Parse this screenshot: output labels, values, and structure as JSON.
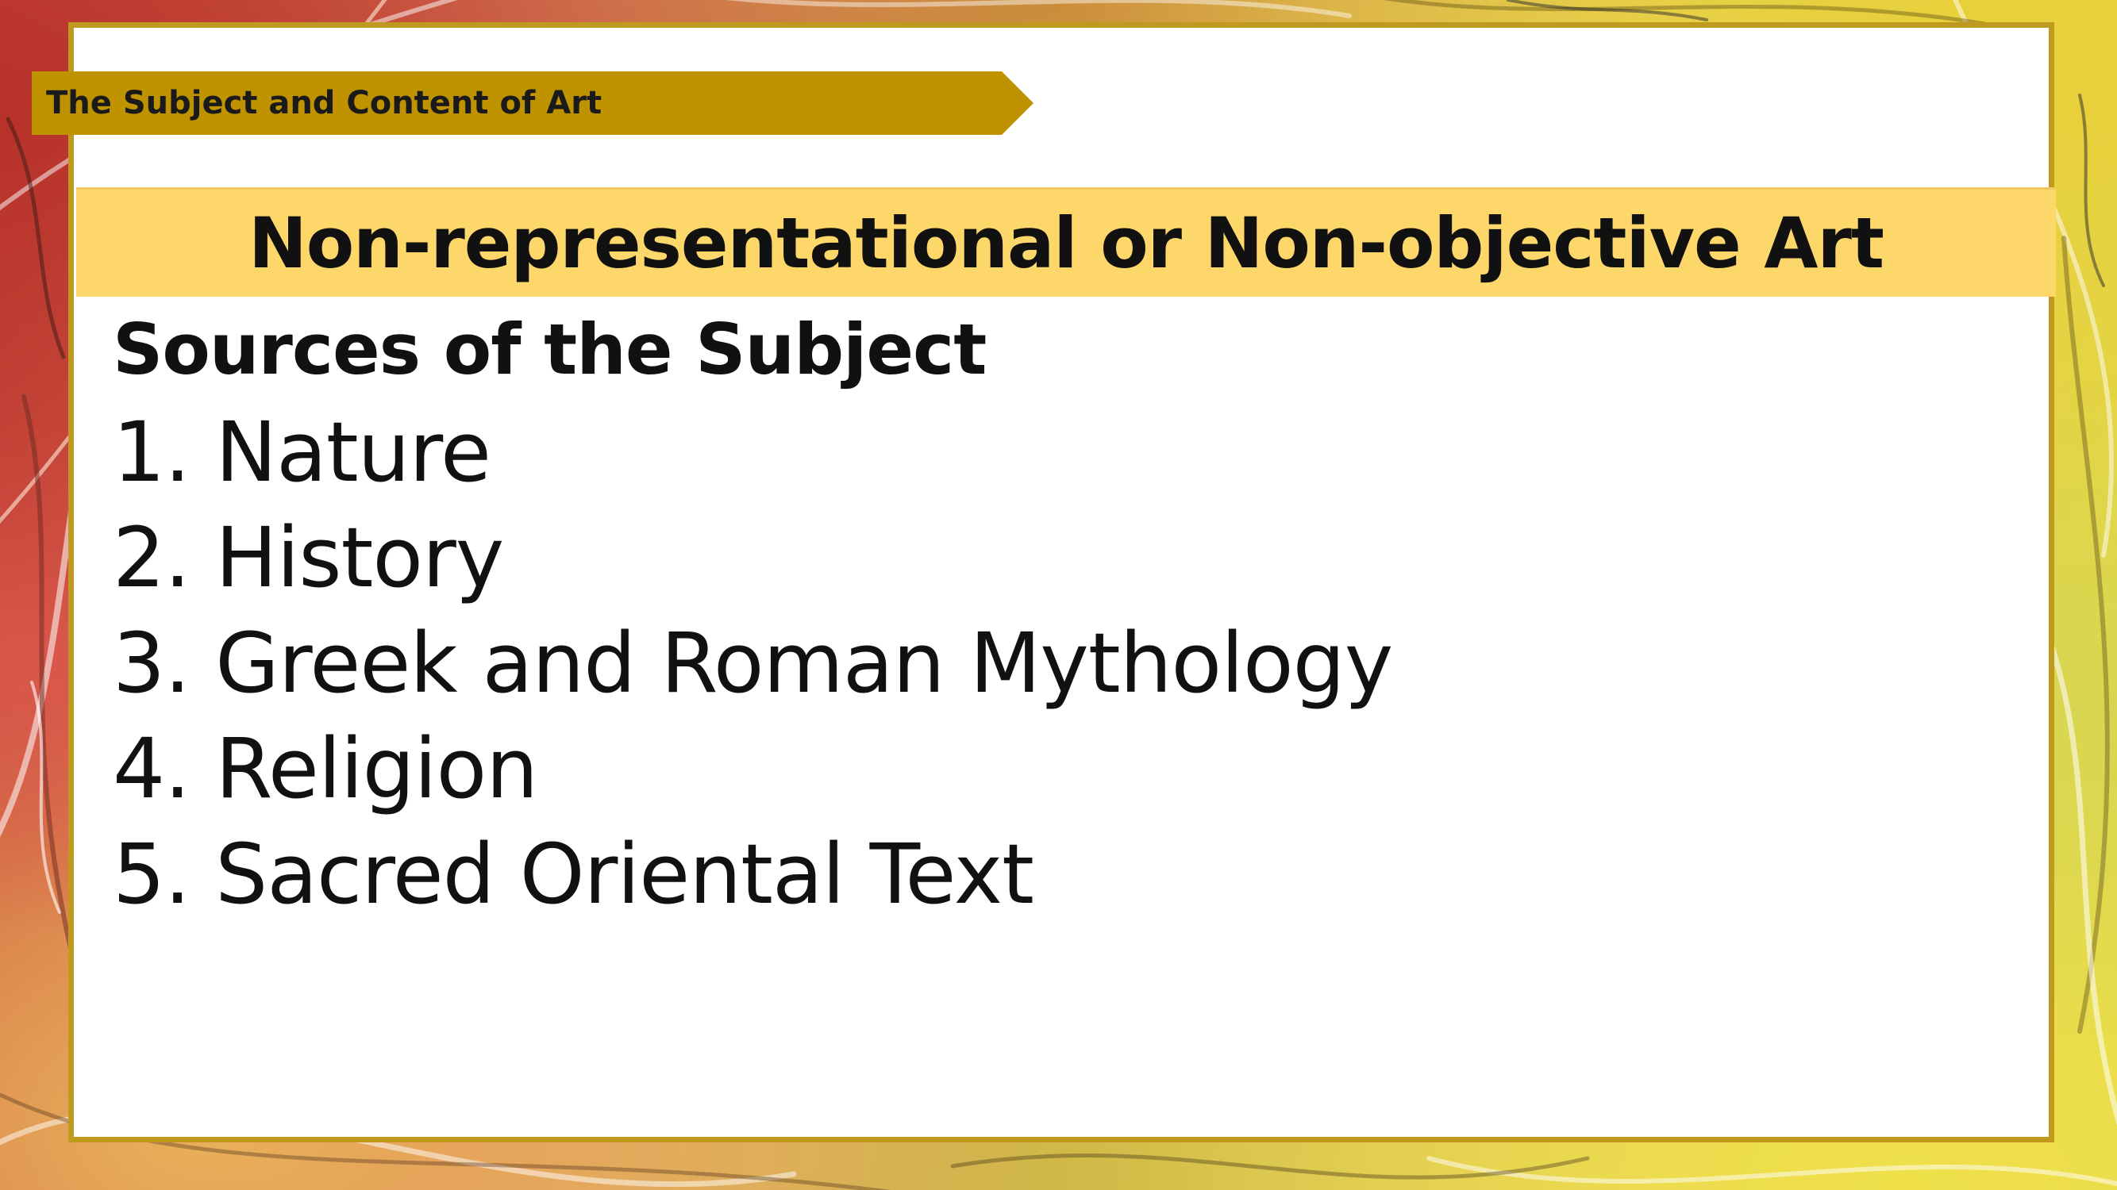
{
  "slide": {
    "section_tag": "The Subject and Content of Art",
    "title": "Non-representational or Non-objective Art",
    "subheading": "Sources of the Subject",
    "items": [
      {
        "number": "1.",
        "label": "Nature"
      },
      {
        "number": "2.",
        "label": "History"
      },
      {
        "number": "3.",
        "label": "Greek and Roman Mythology"
      },
      {
        "number": "4.",
        "label": "Religion"
      },
      {
        "number": "5.",
        "label": "Sacred Oriental Text"
      }
    ]
  },
  "colors": {
    "frame_border": "#c09a1e",
    "section_tag_bg": "#bf9300",
    "title_bar_bg": "#fdd769",
    "text": "#111111"
  }
}
